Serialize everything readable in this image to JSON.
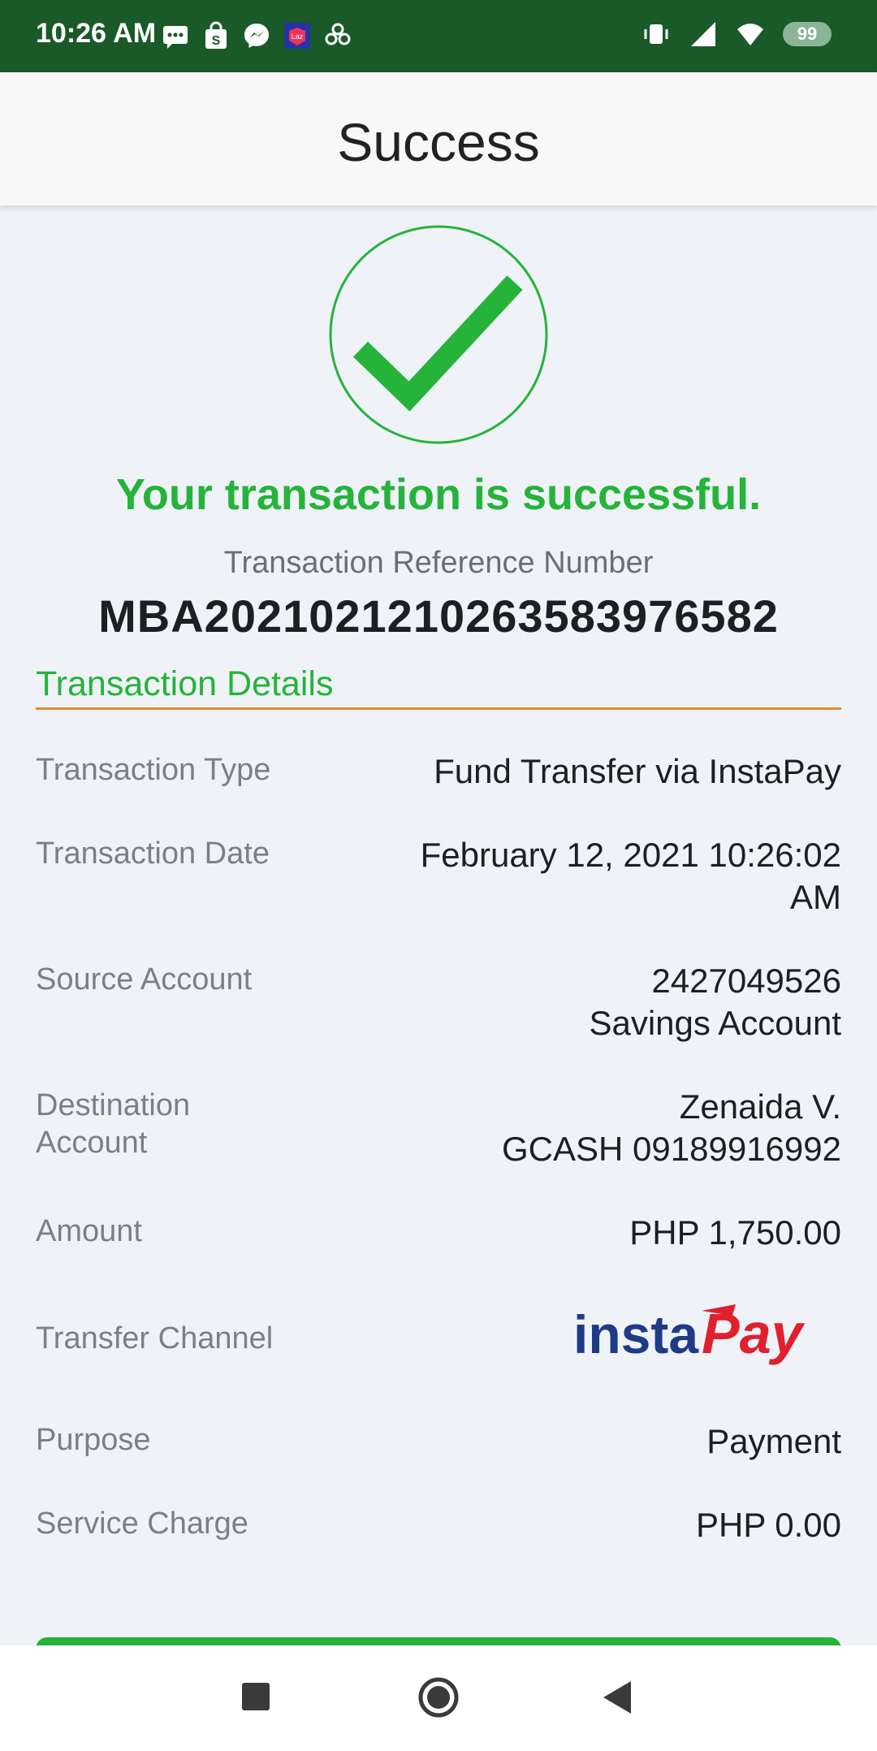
{
  "status_bar": {
    "time": "10:26 AM",
    "battery": "99",
    "icons_left": [
      "message-icon",
      "shopping-bag-icon",
      "messenger-icon",
      "lazada-icon",
      "pinwheel-icon"
    ],
    "icons_right": [
      "vibrate-icon",
      "signal-icon",
      "wifi-icon",
      "battery-icon"
    ]
  },
  "header": {
    "title": "Success"
  },
  "success": {
    "icon": "checkmark-circle-icon",
    "message": "Your transaction is successful.",
    "reference_label": "Transaction Reference Number",
    "reference_number": "MBA20210212102635839765 82"
  },
  "details": {
    "section_title": "Transaction Details",
    "rows": [
      {
        "label": "Transaction Type",
        "value": "Fund Transfer via InstaPay"
      },
      {
        "label": "Transaction Date",
        "value": "February 12, 2021 10:26:02\nAM"
      },
      {
        "label": "Source Account",
        "value": "2427049526\nSavings Account"
      },
      {
        "label": "Destination\nAccount",
        "value": "Zenaida V.\nGCASH 09189916992"
      },
      {
        "label": "Amount",
        "value": "PHP 1,750.00"
      },
      {
        "label": "Transfer Channel",
        "value": "instaPay",
        "logo_text_1": "insta",
        "logo_text_2": "Pay"
      },
      {
        "label": "Purpose",
        "value": "Payment"
      },
      {
        "label": "Service Charge",
        "value": "PHP 0.00"
      }
    ]
  },
  "colors": {
    "status_bar": "#1a5a28",
    "success_green": "#25b33a",
    "divider_orange": "#e9882c",
    "instapay_blue": "#1f3b86",
    "instapay_red": "#e0202f"
  },
  "nav": {
    "icons": [
      "recents-square-icon",
      "home-circle-icon",
      "back-triangle-icon"
    ]
  }
}
